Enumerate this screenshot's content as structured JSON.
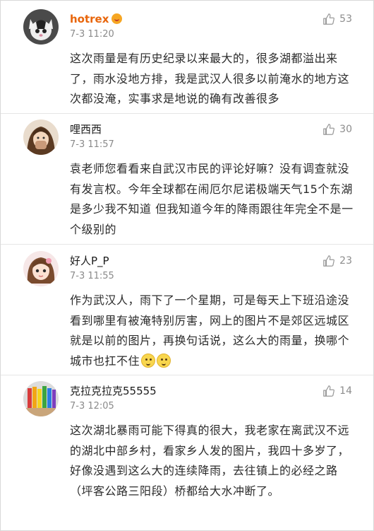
{
  "comments": [
    {
      "username": "hotrex",
      "time": "7-3 11:20",
      "likes": "53",
      "text": "这次雨量是有历史纪录以来最大的，很多湖都溢出来了，雨水没地方排，我是武汉人很多以前淹水的地方这次都没淹，实事求是地说的确有改善很多"
    },
    {
      "username": "哩西西",
      "time": "7-3 11:57",
      "likes": "30",
      "text": "袁老师您看看来自武汉市民的评论好嘛？没有调查就没有发言权。今年全球都在闹厄尔尼诺极端天气15个东湖是多少我不知道 但我知道今年的降雨跟往年完全不是一个级别的"
    },
    {
      "username": "好人P_P",
      "time": "7-3 11:55",
      "likes": "23",
      "text": "作为武汉人，雨下了一个星期，可是每天上下班沿途没看到哪里有被淹特别厉害，网上的图片不是郊区远城区就是以前的图片，再换句话说，这么大的雨量，换哪个城市也扛不住"
    },
    {
      "username": "克拉克拉克55555",
      "time": "7-3 12:05",
      "likes": "14",
      "text": "这次湖北暴雨可能下得真的很大，我老家在离武汉不远的湖北中部乡村，看家乡人发的图片，我四十多岁了，好像没遇到这么大的连续降雨，去往镇上的必经之路（坪客公路三阳段）桥都给大水冲断了。"
    }
  ],
  "icons": {
    "like": "thumbs-up-icon",
    "vip": "vip-emoji-icon",
    "inline_emoji": "thinking-face-emoji-icon"
  },
  "colors": {
    "highlight_username": "#e8650a",
    "meta_gray": "#8a8a8a"
  }
}
